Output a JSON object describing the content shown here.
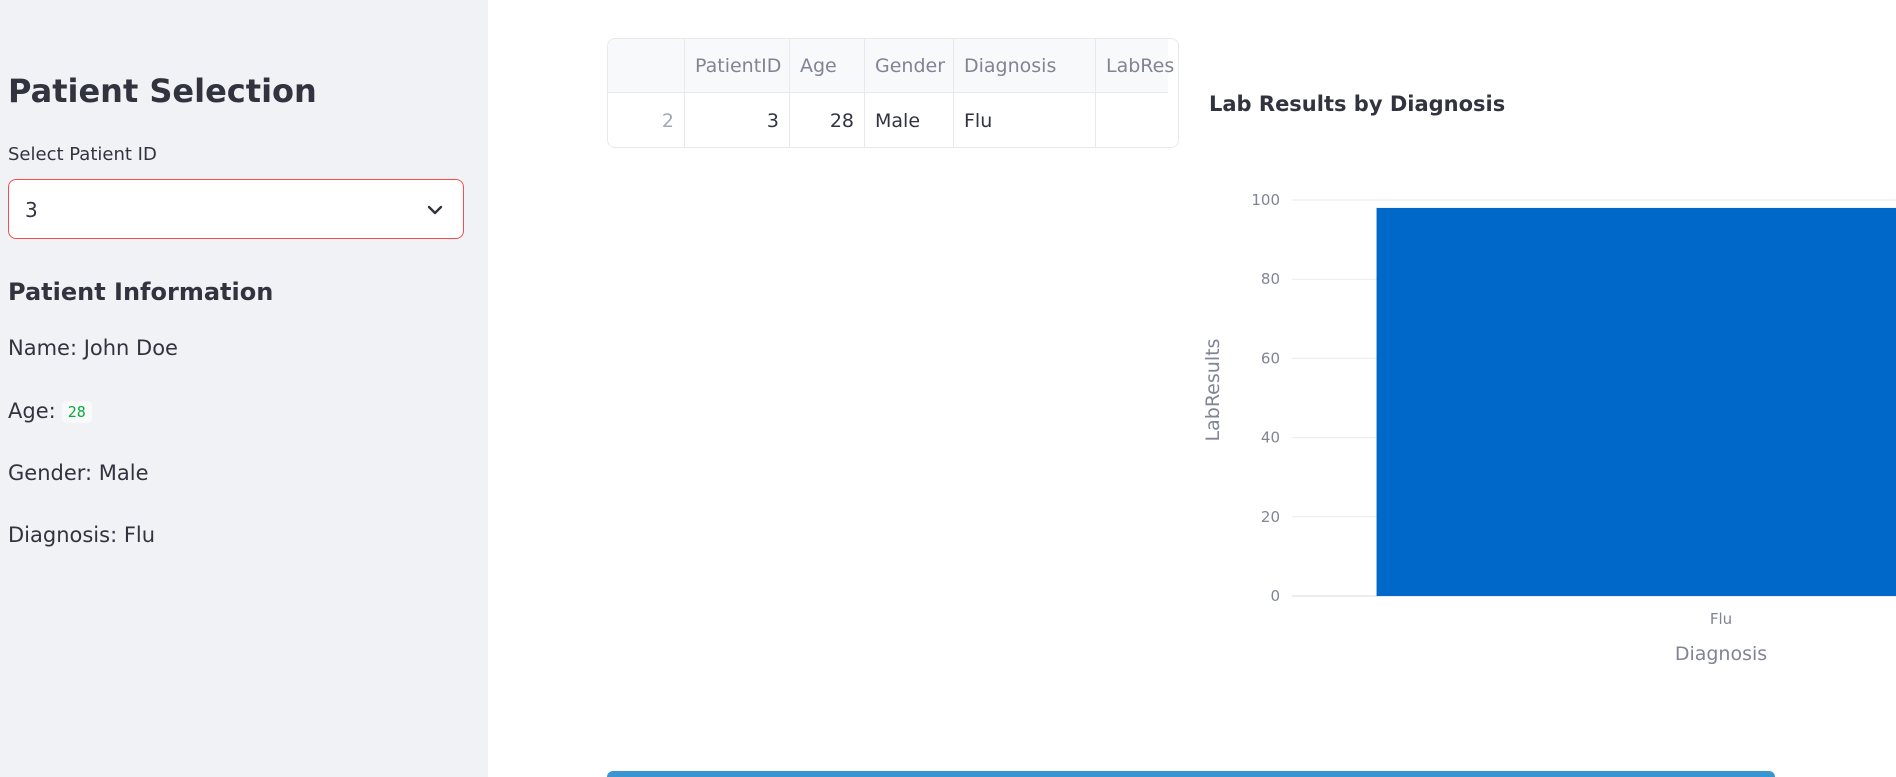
{
  "sidebar": {
    "title": "Patient Selection",
    "select_label": "Select Patient ID",
    "selected_value": "3",
    "info_heading": "Patient Information",
    "name_line": "Name: John Doe",
    "age_label": "Age:",
    "age_value": "28",
    "gender_line": "Gender: Male",
    "diagnosis_line": "Diagnosis: Flu"
  },
  "main": {
    "table": {
      "columns": [
        "",
        "PatientID",
        "Age",
        "Gender",
        "Diagnosis",
        "LabRes"
      ],
      "rows": [
        [
          "2",
          "3",
          "28",
          "Male",
          "Flu",
          ""
        ]
      ]
    }
  },
  "chart_data": {
    "type": "bar",
    "title": "Lab Results by Diagnosis",
    "xlabel": "Diagnosis",
    "ylabel": "LabResults",
    "categories": [
      "Flu"
    ],
    "values": [
      98
    ],
    "ylim": [
      0,
      100
    ],
    "yticks": [
      0,
      20,
      40,
      60,
      80,
      100
    ],
    "grid": true,
    "color": "#0068c9"
  },
  "colors": {
    "accent": "#ff4b4b",
    "sidebar_bg": "#f0f2f6",
    "bar": "#0068c9",
    "code_green": "#09ab3b",
    "bottom_bar": "#3a95d3"
  }
}
